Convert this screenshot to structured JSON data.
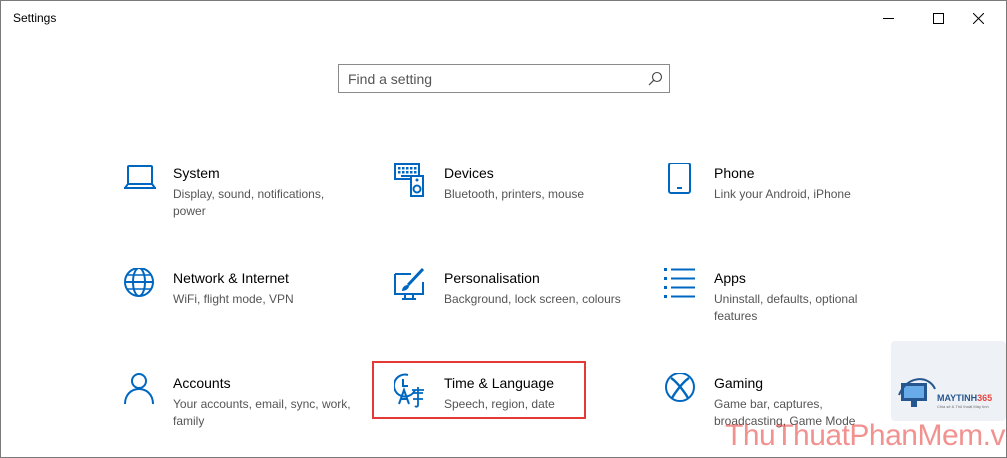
{
  "window": {
    "title": "Settings",
    "controls": {
      "minimize": "minimize-icon",
      "maximize": "maximize-icon",
      "close": "close-icon"
    }
  },
  "search": {
    "placeholder": "Find a setting",
    "icon": "search-icon"
  },
  "accent_color": "#0067c0",
  "highlight_color": "#e53935",
  "tiles": [
    {
      "icon": "laptop-icon",
      "title": "System",
      "description": "Display, sound, notifications, power"
    },
    {
      "icon": "keyboard-speaker-icon",
      "title": "Devices",
      "description": "Bluetooth, printers, mouse"
    },
    {
      "icon": "phone-icon",
      "title": "Phone",
      "description": "Link your Android, iPhone"
    },
    {
      "icon": "globe-icon",
      "title": "Network & Internet",
      "description": "WiFi, flight mode, VPN"
    },
    {
      "icon": "paint-brush-icon",
      "title": "Personalisation",
      "description": "Background, lock screen, colours"
    },
    {
      "icon": "apps-list-icon",
      "title": "Apps",
      "description": "Uninstall, defaults, optional features"
    },
    {
      "icon": "person-icon",
      "title": "Accounts",
      "description": "Your accounts, email, sync, work, family"
    },
    {
      "icon": "time-language-icon",
      "title": "Time & Language",
      "description": "Speech, region, date"
    },
    {
      "icon": "xbox-icon",
      "title": "Gaming",
      "description": "Game bar, captures, broadcasting, Game Mode"
    }
  ],
  "watermark": {
    "badge_brand": "MAYTINH",
    "badge_number": "365",
    "badge_tagline": "Chia sẻ & Thủ thuật Máy tính",
    "site_text": "ThuThuatPhanMem.vn"
  }
}
